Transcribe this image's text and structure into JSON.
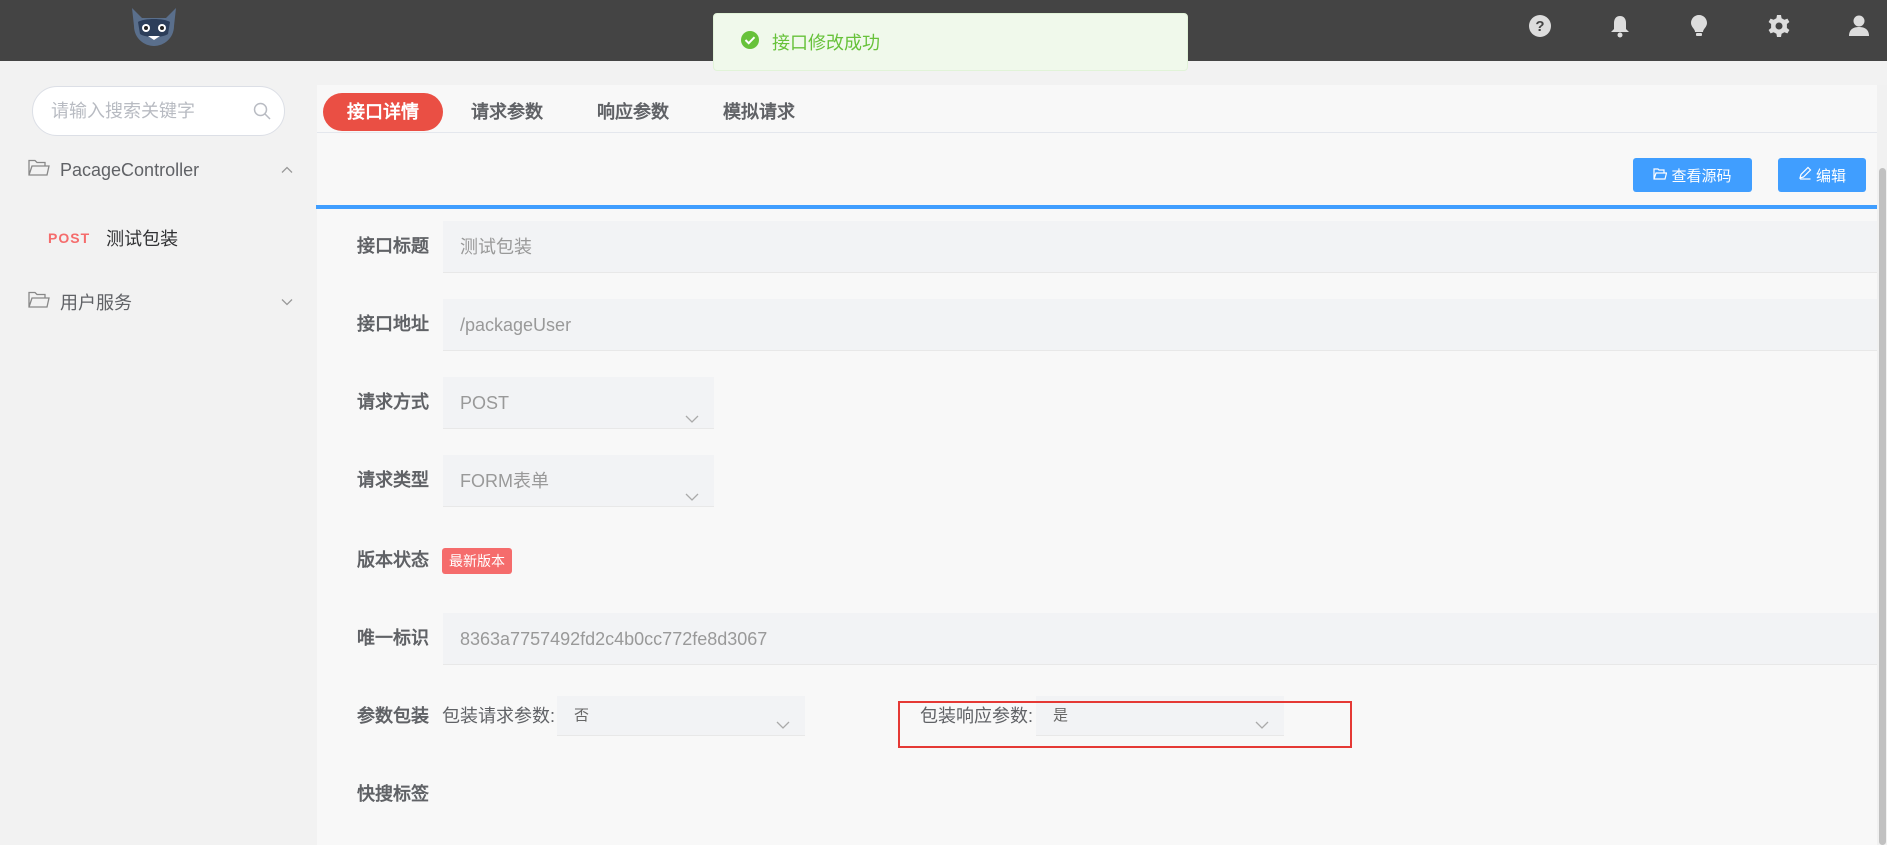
{
  "toast": {
    "message": "接口修改成功",
    "color": "#67c23a"
  },
  "header": {
    "icons": [
      "help-icon",
      "bell-icon",
      "bulb-icon",
      "settings-icon",
      "user-icon"
    ]
  },
  "sidebar": {
    "search_placeholder": "请输入搜索关键字",
    "groups": [
      {
        "label": "PacageController",
        "expanded": true
      },
      {
        "label": "用户服务",
        "expanded": false
      }
    ],
    "leaf": {
      "method": "POST",
      "label": "测试包装"
    }
  },
  "tabs": [
    "接口详情",
    "请求参数",
    "响应参数",
    "模拟请求"
  ],
  "buttons": {
    "source": "查看源码",
    "edit": "编辑"
  },
  "form": {
    "title_label": "接口标题",
    "title_value": "测试包装",
    "url_label": "接口地址",
    "url_value": "/packageUser",
    "method_label": "请求方式",
    "method_value": "POST",
    "type_label": "请求类型",
    "type_value": "FORM表单",
    "version_label": "版本状态",
    "version_badge": "最新版本",
    "uid_label": "唯一标识",
    "uid_value": "8363a7757492fd2c4b0cc772fe8d3067",
    "wrap_label": "参数包装",
    "wrap_req_label": "包装请求参数:",
    "wrap_req_value": "否",
    "wrap_resp_label": "包装响应参数:",
    "wrap_resp_value": "是",
    "tags_label": "快搜标签"
  },
  "colors": {
    "accent": "#409eff",
    "active_tab": "#ea4f44",
    "badge": "#f56c6c",
    "header_bg": "#444444"
  }
}
